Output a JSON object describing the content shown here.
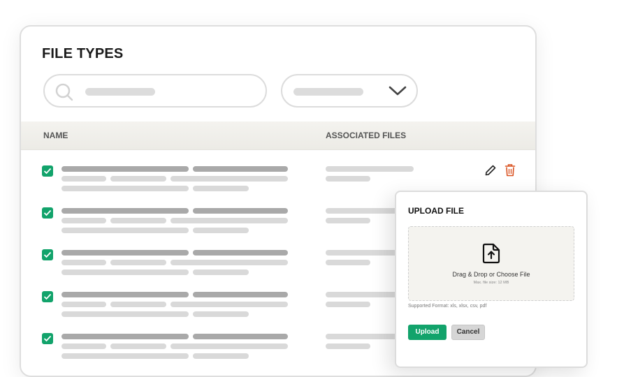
{
  "page": {
    "title": "FILE TYPES"
  },
  "search": {
    "icon": "search-icon"
  },
  "filter": {
    "icon": "chevron-down-icon"
  },
  "table": {
    "columns": [
      "NAME",
      "ASSOCIATED FILES"
    ],
    "rows": [
      {
        "checked": true,
        "actions": [
          "edit-icon",
          "delete-icon"
        ]
      },
      {
        "checked": true
      },
      {
        "checked": true
      },
      {
        "checked": true
      },
      {
        "checked": true
      }
    ]
  },
  "upload_modal": {
    "title": "UPLOAD FILE",
    "dropzone_text": "Drag & Drop or Choose File",
    "max_size_text": "Max. file size: 12 MB",
    "supported_formats": "Supported Format: xls, xlsx, csv, pdf",
    "upload_label": "Upload",
    "cancel_label": "Cancel"
  },
  "colors": {
    "accent": "#12a36b",
    "delete": "#d9501f",
    "header_bg": "#f0efea"
  }
}
